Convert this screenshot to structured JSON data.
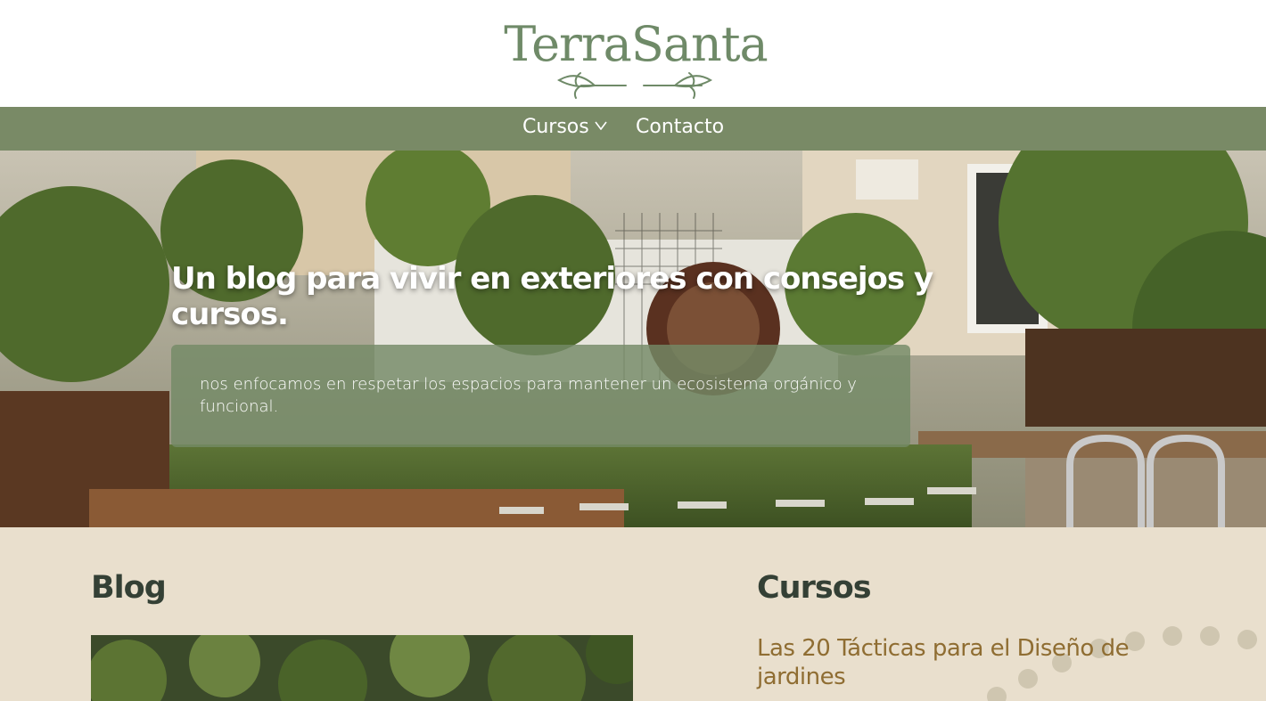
{
  "brand": {
    "name": "TerraSanta",
    "color": "#6f8a68"
  },
  "nav": {
    "items": [
      {
        "label": "Cursos",
        "has_dropdown": true
      },
      {
        "label": "Contacto",
        "has_dropdown": false
      }
    ],
    "background": "#798a66"
  },
  "hero": {
    "title": "Un blog para vivir en exteriores con consejos y cursos.",
    "description": "nos enfocamos en respetar los espacios para mantener un ecosistema orgánico y funcional."
  },
  "sections": {
    "blog": {
      "heading": "Blog"
    },
    "cursos": {
      "heading": "Cursos",
      "first_course": "Las 20 Tácticas para el Diseño de jardines"
    }
  },
  "colors": {
    "content_background": "#e9dfcd",
    "heading": "#344035",
    "course_link": "#8f6d32"
  },
  "icons": [
    "chevron-down-icon",
    "leaf-ornament-icon"
  ]
}
